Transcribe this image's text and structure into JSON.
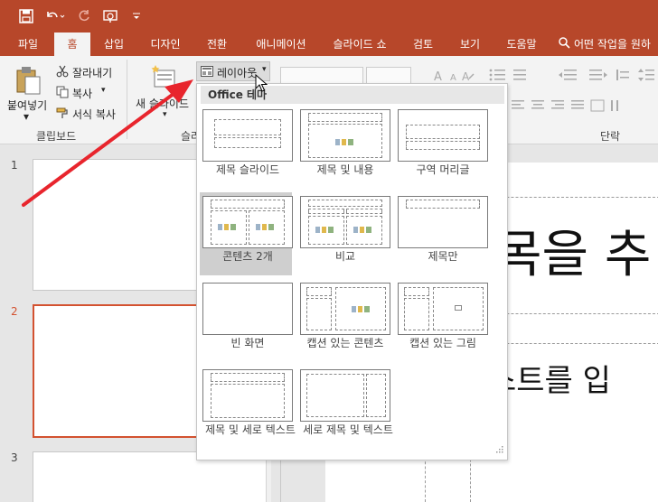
{
  "quick_access": {
    "save_icon": "save-icon",
    "undo_icon": "undo-icon",
    "redo_icon": "redo-icon",
    "present_icon": "present-icon",
    "customize_icon": "customize-icon"
  },
  "tabs": [
    "파일",
    "홈",
    "삽입",
    "디자인",
    "전환",
    "애니메이션",
    "슬라이드 쇼",
    "검토",
    "보기",
    "도움말"
  ],
  "active_tab": "홈",
  "tell_me": "어떤 작업을 원하",
  "clipboard": {
    "paste": "붙여넣기",
    "cut": "잘라내기",
    "copy": "복사",
    "format_painter": "서식 복사",
    "label": "클립보드"
  },
  "slides_group": {
    "new_slide": "새 슬라이드",
    "layout_button": "레이아웃",
    "label_partial": "슬라"
  },
  "paragraph_label": "단락",
  "dropdown": {
    "header": "Office 테마",
    "layouts": [
      {
        "label": "제목 슬라이드"
      },
      {
        "label": "제목 및 내용"
      },
      {
        "label": "구역 머리글"
      },
      {
        "label": "콘텐츠 2개"
      },
      {
        "label": "비교"
      },
      {
        "label": "제목만"
      },
      {
        "label": "빈 화면"
      },
      {
        "label": "캡션 있는 콘텐츠"
      },
      {
        "label": "캡션 있는 그림"
      },
      {
        "label": "제목 및 세로 텍스트"
      },
      {
        "label": "세로 제목 및 텍스트"
      }
    ],
    "selected_layout": "콘텐츠 2개"
  },
  "slide_numbers": [
    "1",
    "2",
    "3"
  ],
  "slide_text": {
    "title_partial": "목을 추",
    "subtitle_partial": "스트를 입"
  },
  "colors": {
    "accent": "#b7472a",
    "selection": "#d35230",
    "arrow": "#e8252d"
  }
}
